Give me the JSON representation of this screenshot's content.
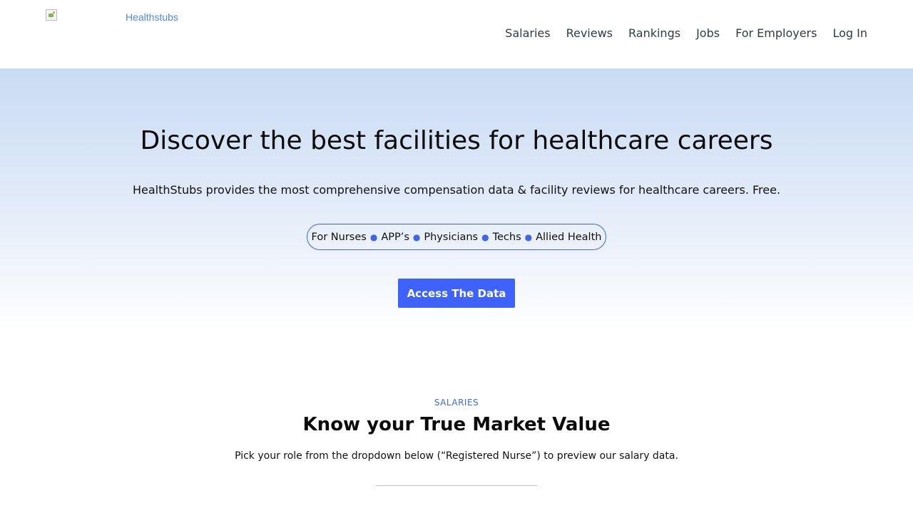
{
  "header": {
    "logo_alt": "Healthstubs",
    "nav": [
      "Salaries",
      "Reviews",
      "Rankings",
      "Jobs",
      "For Employers",
      "Log In"
    ]
  },
  "hero": {
    "title": "Discover the best facilities for healthcare careers",
    "subtitle": "HealthStubs provides the most comprehensive compensation data & facility reviews for healthcare careers. Free.",
    "audiences": [
      "For Nurses",
      "APP’s",
      "Physicians",
      "Techs",
      "Allied Health"
    ],
    "cta_label": "Access The Data"
  },
  "salaries": {
    "label": "SALARIES",
    "title": "Know your True Market Value",
    "text": "Pick your role from the dropdown below (“Registered Nurse”) to preview our salary data."
  },
  "colors": {
    "accent": "#3e62ff",
    "label_blue": "#3f66e6",
    "hero_top": "#c9dbf4"
  },
  "icons": {
    "logo": "broken-image-icon"
  }
}
